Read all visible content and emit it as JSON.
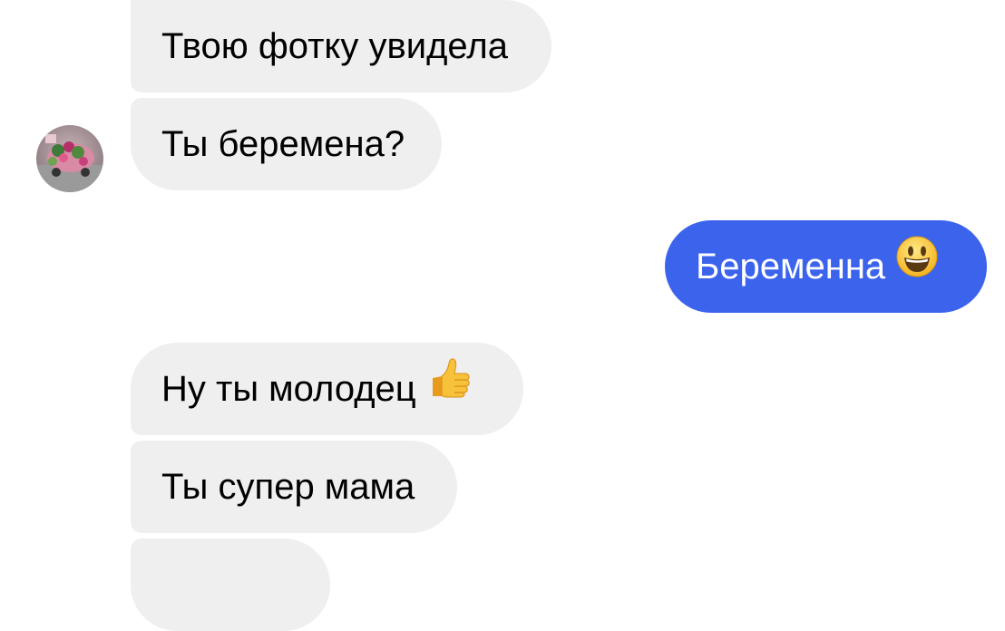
{
  "conversation": {
    "messages": [
      {
        "sender": "contact",
        "text": "Твою фотку увидела"
      },
      {
        "sender": "contact",
        "text": "Ты беремена?"
      },
      {
        "sender": "me",
        "text": "Беременна",
        "emoji": "smiling-face-emoji"
      },
      {
        "sender": "contact",
        "text": "Ну ты молодец",
        "emoji": "thumbs-up-emoji"
      },
      {
        "sender": "contact",
        "text": "Ты супер мама"
      },
      {
        "sender": "contact",
        "text": ""
      }
    ]
  },
  "contact": {
    "avatar_icon": "contact-avatar-photo"
  },
  "colors": {
    "incoming_bubble": "#efefef",
    "outgoing_bubble": "#3b63ec",
    "incoming_text": "#000000",
    "outgoing_text": "#ffffff"
  }
}
